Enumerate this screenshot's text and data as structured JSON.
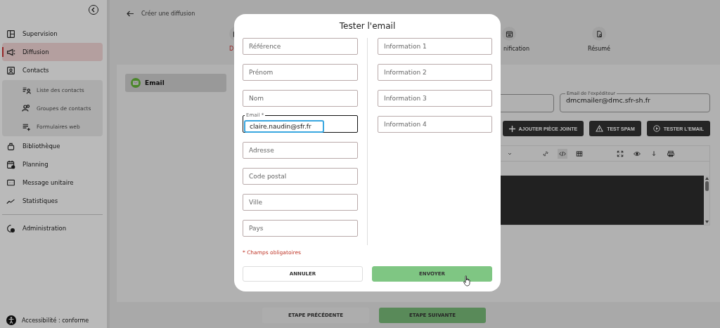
{
  "sidebar": {
    "items": [
      {
        "label": "Supervision",
        "selected": false
      },
      {
        "label": "Diffusion",
        "selected": true
      },
      {
        "label": "Contacts",
        "selected": false,
        "children": [
          {
            "label": "Liste des contacts",
            "selected": false
          },
          {
            "label": "Groupes de contacts",
            "selected": false
          },
          {
            "label": "Formulaires web",
            "selected": false
          }
        ]
      },
      {
        "label": "Bibliothèque",
        "selected": false
      },
      {
        "label": "Planning",
        "selected": false
      },
      {
        "label": "Message unitaire",
        "selected": false
      },
      {
        "label": "Statistiques",
        "selected": false
      },
      {
        "label": "Administration",
        "selected": false
      }
    ],
    "footer": "Accessibilité : conforme"
  },
  "header": {
    "title": "Créer une diffusion"
  },
  "stepper": [
    {
      "label": "D",
      "selected": true
    },
    {
      "label": "nification",
      "selected": false
    },
    {
      "label": "Résumé",
      "selected": false
    }
  ],
  "channels": [
    {
      "label": "Email",
      "selected": true
    }
  ],
  "sender": {
    "label": "Email de l'expéditeur",
    "value": "dmcmailer@dmc.sfr-sh.fr"
  },
  "actions": [
    "AJOUTER PIÈCE JOINTE",
    "TEST SPAM",
    "TESTER L'EMAIL"
  ],
  "footer_buttons": [
    {
      "label": "ETAPE PRÉCÉDENTE",
      "kind": "secondary"
    },
    {
      "label": "ETAPE SUIVANTE",
      "kind": "primary"
    }
  ],
  "modal": {
    "title": "Tester l'email",
    "left_fields": [
      {
        "placeholder": "Référence"
      },
      {
        "placeholder": "Prénom"
      },
      {
        "placeholder": "Nom"
      },
      {
        "label": "Email *",
        "value": "claire.naudin@sfr.fr"
      },
      {
        "placeholder": "Adresse"
      },
      {
        "placeholder": "Code postal"
      },
      {
        "placeholder": "Ville"
      },
      {
        "placeholder": "Pays"
      }
    ],
    "right_fields": [
      {
        "placeholder": "Information 1"
      },
      {
        "placeholder": "Information 2"
      },
      {
        "placeholder": "Information 3"
      },
      {
        "placeholder": "Information 4"
      }
    ],
    "required_note": "* Champs obligatoires",
    "buttons": [
      {
        "label": "ANNULER",
        "kind": "secondary"
      },
      {
        "label": "ENVOYER",
        "kind": "primary"
      }
    ]
  }
}
